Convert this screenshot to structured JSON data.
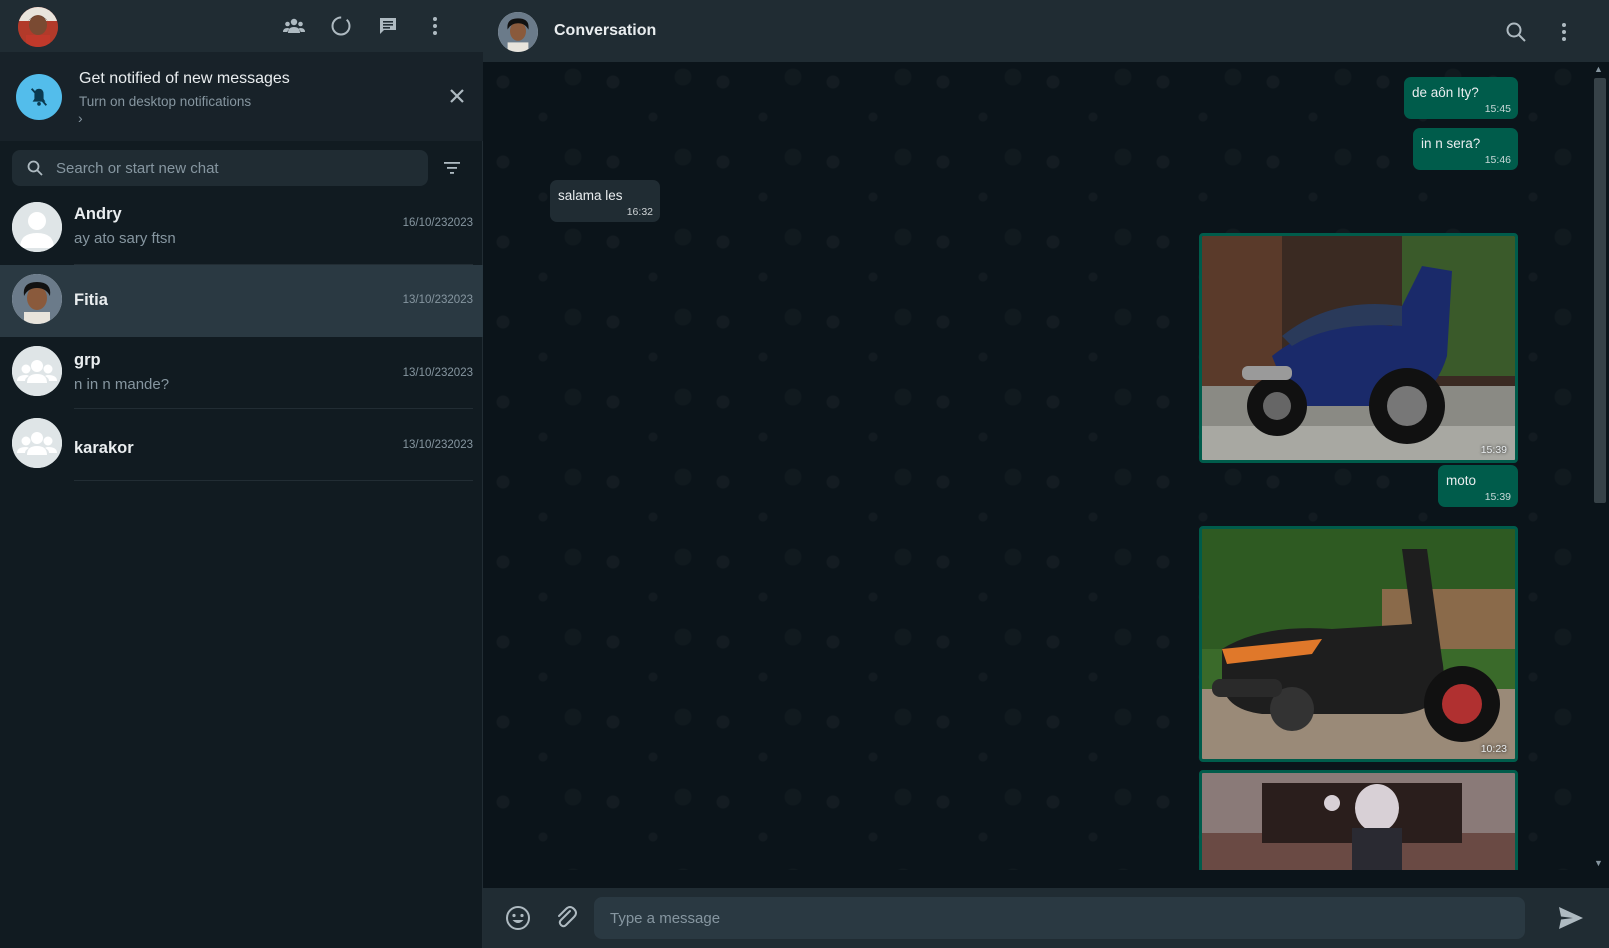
{
  "left_header": {
    "icons": [
      "communities-icon",
      "status-icon",
      "new-chat-icon",
      "menu-icon"
    ]
  },
  "notification": {
    "title": "Get notified of new messages",
    "subtitle": "Turn on desktop notifications",
    "chevron": "›"
  },
  "search": {
    "placeholder": "Search or start new chat"
  },
  "chats": [
    {
      "name": "Andry",
      "preview": "ay ato sary ftsn",
      "date": "16/10/232023"
    },
    {
      "name": "Fitia",
      "preview": "",
      "date": "13/10/232023"
    },
    {
      "name": "grp",
      "preview": "n in n mande?",
      "date": "13/10/232023"
    },
    {
      "name": "karakor",
      "preview": "",
      "date": "13/10/232023"
    }
  ],
  "conversation": {
    "title": "Conversation",
    "messages": [
      {
        "direction": "out",
        "text": "de aôn Ity?",
        "time": "15:45"
      },
      {
        "direction": "out",
        "text": "in n sera?",
        "time": "15:46"
      },
      {
        "direction": "in",
        "text": "salama les",
        "time": "16:32"
      },
      {
        "direction": "out",
        "type": "image",
        "subject": "blue scooter",
        "time": "15:39"
      },
      {
        "direction": "out",
        "text": "moto",
        "time": "15:39"
      },
      {
        "direction": "out",
        "type": "image",
        "subject": "black scooter",
        "time": "10:23"
      },
      {
        "direction": "out",
        "type": "image",
        "subject": "anime figure",
        "time": ""
      }
    ]
  },
  "composer": {
    "placeholder": "Type a message"
  },
  "colors": {
    "panel": "#111b21",
    "header": "#202c33",
    "outgoing": "#005c4b",
    "incoming": "#202c33",
    "accent": "#53bdeb"
  }
}
